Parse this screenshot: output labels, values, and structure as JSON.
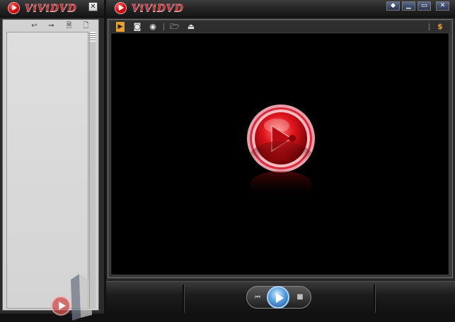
{
  "playlist_window": {
    "brand": "ViViDVD",
    "close_glyph": "✕",
    "tools": [
      {
        "icon": "return-arrow-icon",
        "glyph": "↩"
      },
      {
        "icon": "arrow-right-icon",
        "glyph": "➞"
      },
      {
        "icon": "add-file-icon",
        "glyph": "🗎"
      },
      {
        "icon": "file-icon",
        "glyph": "🗋"
      }
    ]
  },
  "player_window": {
    "brand": "ViViDVD",
    "window_buttons": [
      {
        "icon": "restore-icon",
        "glyph": "◆"
      },
      {
        "icon": "minimize-icon",
        "glyph": "▁"
      },
      {
        "icon": "maximize-icon",
        "glyph": "▭"
      },
      {
        "icon": "close-icon",
        "glyph": "✕"
      }
    ],
    "toolbar": {
      "play_file_glyph": "▶",
      "capture_glyph": "◙",
      "snapshot_glyph": "◉",
      "open_folder_glyph": "🗁",
      "eject_glyph": "⏏",
      "currency_glyph": "$"
    },
    "transport": {
      "prev_glyph": "⏮",
      "next_glyph": "⏭",
      "stop_glyph": "■"
    }
  },
  "colors": {
    "brand_red": "#c9353c",
    "play_blue": "#5aa0de",
    "video_bg": "#000000",
    "accent_orange": "#e8a030"
  }
}
